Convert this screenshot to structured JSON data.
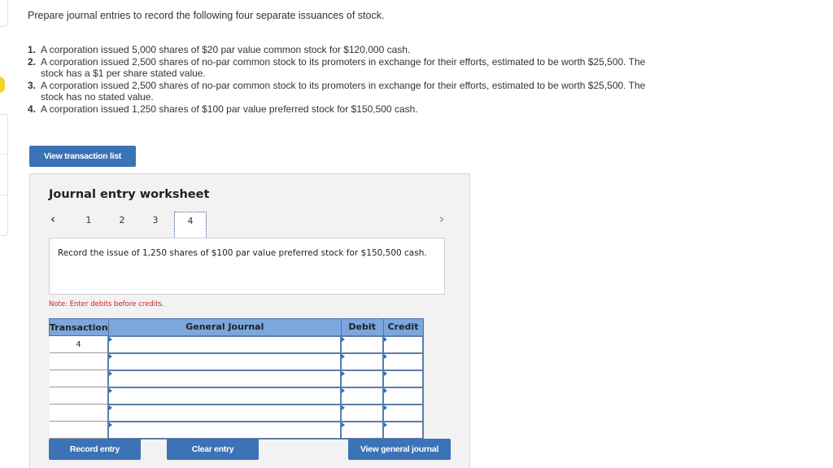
{
  "intro": "Prepare journal entries to record the following four separate issuances of stock.",
  "questions": [
    {
      "num": "1.",
      "text": "A corporation issued 5,000 shares of $20 par value common stock for $120,000 cash."
    },
    {
      "num": "2.",
      "text": "A corporation issued 2,500 shares of no-par common stock to its promoters in exchange for their efforts, estimated to be worth $25,500. The stock has a $1 per share stated value."
    },
    {
      "num": "3.",
      "text": "A corporation issued 2,500 shares of no-par common stock to its promoters in exchange for their efforts, estimated to be worth $25,500. The stock has no stated value."
    },
    {
      "num": "4.",
      "text": "A corporation issued 1,250 shares of $100 par value preferred stock for $150,500 cash."
    }
  ],
  "view_transaction_list_label": "View transaction list",
  "worksheet": {
    "title": "Journal entry worksheet",
    "prev_icon": "‹",
    "next_icon": "›",
    "tabs": [
      "1",
      "2",
      "3",
      "4"
    ],
    "active_tab": "4",
    "description": "Record the issue of 1,250 shares of $100 par value preferred stock for $150,500 cash.",
    "note": "Note: Enter debits before credits.",
    "table": {
      "headers": [
        "Transaction",
        "General Journal",
        "Debit",
        "Credit"
      ],
      "rows": [
        {
          "transaction": "4",
          "account": "",
          "debit": "",
          "credit": ""
        },
        {
          "transaction": "",
          "account": "",
          "debit": "",
          "credit": ""
        },
        {
          "transaction": "",
          "account": "",
          "debit": "",
          "credit": ""
        },
        {
          "transaction": "",
          "account": "",
          "debit": "",
          "credit": ""
        },
        {
          "transaction": "",
          "account": "",
          "debit": "",
          "credit": ""
        },
        {
          "transaction": "",
          "account": "",
          "debit": "",
          "credit": ""
        }
      ]
    },
    "record_entry_label": "Record entry",
    "clear_entry_label": "Clear entry",
    "view_general_journal_label": "View general journal"
  },
  "colors": {
    "button_blue": "#3c72b6",
    "header_blue": "#7ba7dd",
    "note_red": "#c0272d",
    "badge_yellow": "#f8d22a"
  }
}
